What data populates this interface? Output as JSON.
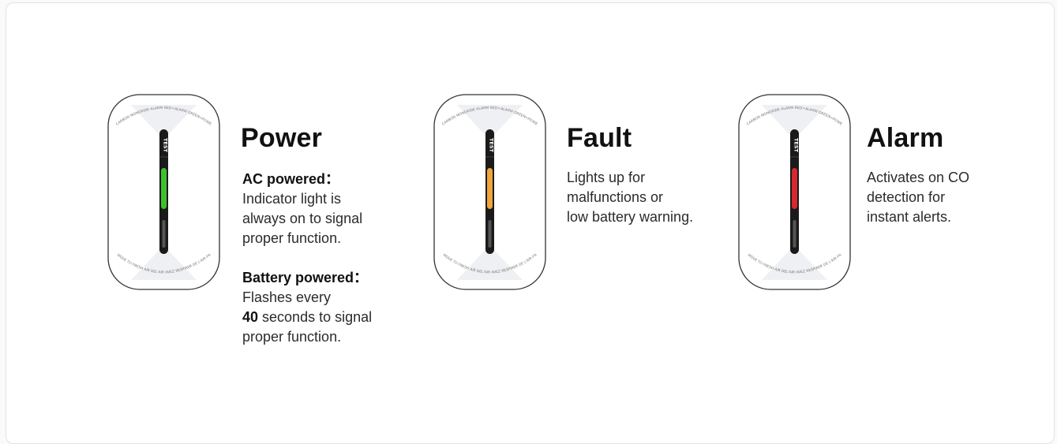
{
  "panels": [
    {
      "title": "Power",
      "led_color": "#3fbf2e",
      "device_label": "TEST",
      "blocks": [
        {
          "heading": "AC powered：",
          "lines": [
            "Indicator light is",
            "always on to signal",
            "proper function."
          ]
        },
        {
          "heading": "Battery powered：",
          "lines": [
            "Flashes every"
          ],
          "emph_number": "40",
          "emph_rest": " seconds to signal",
          "tail": "proper function."
        }
      ]
    },
    {
      "title": "Fault",
      "led_color": "#f0a43a",
      "device_label": "TEST",
      "lines": [
        "Lights up for",
        "malfunctions or",
        "low battery warning."
      ]
    },
    {
      "title": "Alarm",
      "led_color": "#d6282e",
      "device_label": "TEST",
      "lines": [
        "Activates on CO",
        "detection for",
        "instant alerts."
      ]
    }
  ],
  "device_text": {
    "top": "CARBON MONOXIDE ALARM RED=ALARM GREEN=POWER YELLOW=FAULT",
    "bottom": "MOVE TO FRESH AIR DEL'AIR AVEZ RESPIRER DE L'AIR FRAIS A L'EXTERIEUR"
  }
}
